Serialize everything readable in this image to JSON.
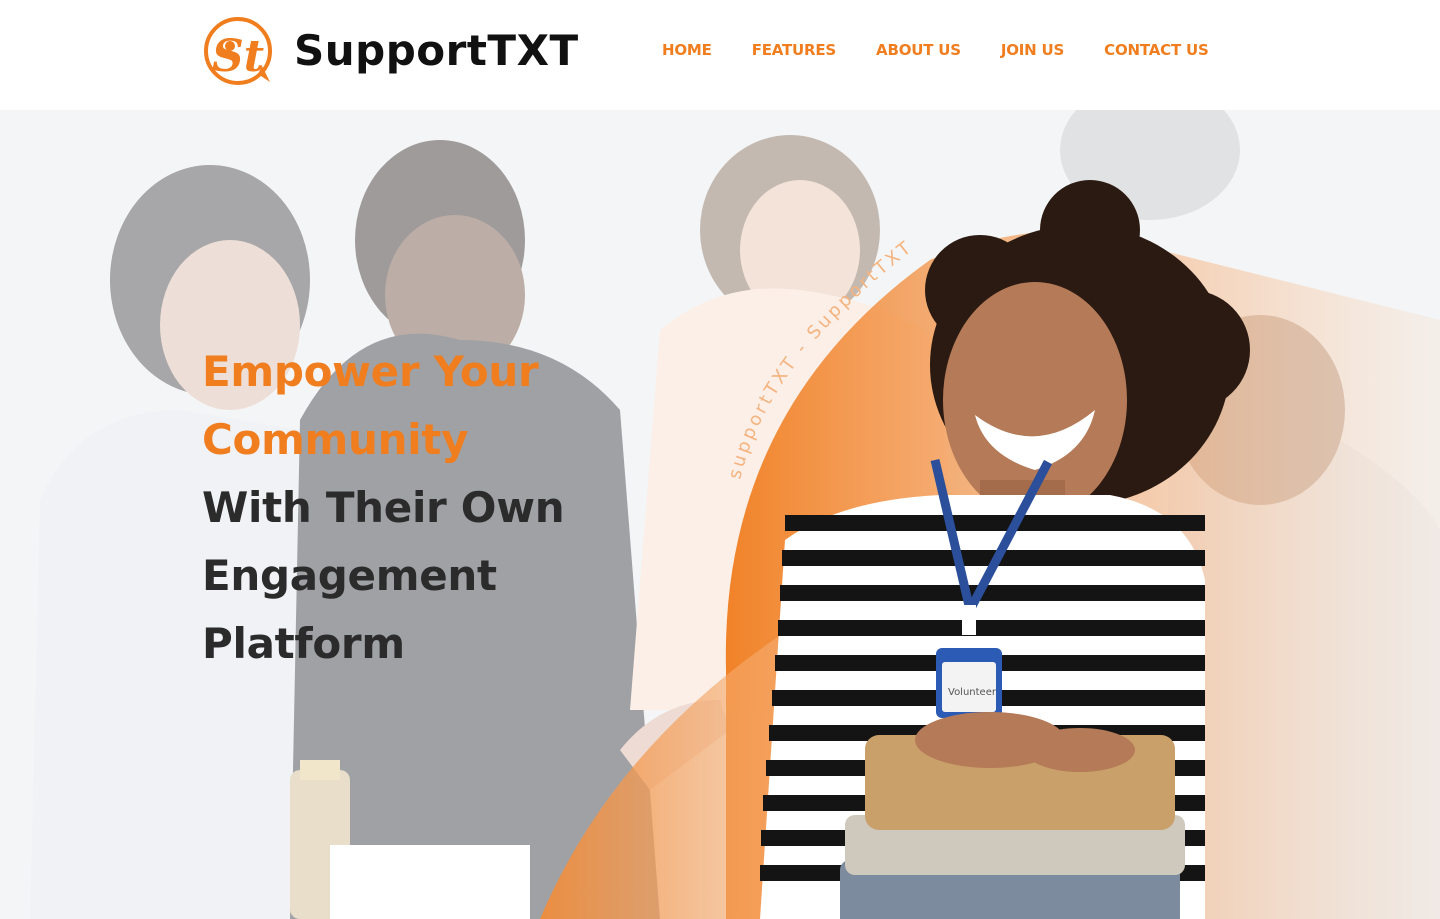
{
  "brand": {
    "name": "SupportTXT",
    "logo_initials": "St",
    "color_primary": "#f07d1e",
    "color_dark": "#111111"
  },
  "nav": {
    "items": [
      {
        "label": "HOME"
      },
      {
        "label": "FEATURES"
      },
      {
        "label": "ABOUT US"
      },
      {
        "label": "JOIN US"
      },
      {
        "label": "CONTACT US"
      }
    ]
  },
  "hero": {
    "heading_accent_lines": [
      "Empower Your",
      "Community"
    ],
    "heading_dark_lines": [
      "With Their Own",
      "Engagement",
      "Platform"
    ],
    "arc_text": "supportTXT - SupportTXT",
    "badge_text": "Volunteer"
  }
}
